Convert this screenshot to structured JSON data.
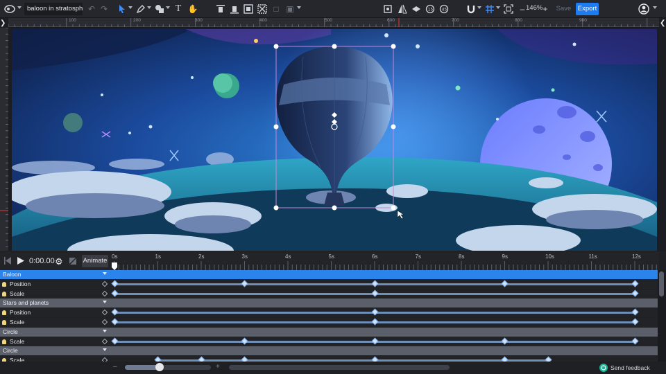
{
  "app": {
    "document_name": "baloon in stratosphere",
    "zoom": "146%",
    "save_label": "Save",
    "export_label": "Export",
    "accent_color": "#1f7cf0"
  },
  "toolbar": {
    "left_icons": [
      "app-logo-icon",
      "undo-icon",
      "redo-icon",
      "pointer-tool-icon",
      "pen-tool-icon",
      "shape-tool-icon",
      "text-tool-icon",
      "hand-tool-icon"
    ],
    "align_icons": [
      "align-top-icon",
      "align-middle-icon",
      "align-group-icon",
      "align-distribute-icon",
      "boolean-icon",
      "arrange-icon"
    ],
    "view_icons": [
      "crop-icon",
      "flip-icon",
      "mask-icon",
      "rotate-left-icon",
      "rotate-right-icon",
      "magnet-icon",
      "grid-icon",
      "fit-icon"
    ],
    "text_tool": "T",
    "zoom_minus": "–",
    "zoom_plus": "+"
  },
  "ruler": {
    "top_labels": [
      "100",
      "200",
      "300",
      "400",
      "500",
      "600",
      "700",
      "800",
      "900"
    ],
    "left_labels": [
      "-100",
      "0",
      "100",
      "200",
      "300"
    ]
  },
  "timeline": {
    "time": "0:00.00",
    "animate_label": "Animate",
    "ticks": [
      "0s",
      "1s",
      "2s",
      "3s",
      "4s",
      "5s",
      "6s",
      "7s",
      "8s",
      "9s",
      "10s",
      "11s",
      "12s"
    ],
    "rows": [
      {
        "type": "group",
        "label": "Baloon",
        "active": true
      },
      {
        "type": "prop",
        "label": "Position",
        "keyframes": [
          0,
          3,
          6,
          9,
          12
        ]
      },
      {
        "type": "prop",
        "label": "Scale",
        "keyframes": [
          0,
          6,
          12
        ]
      },
      {
        "type": "group",
        "label": "Stars and planets",
        "active": false
      },
      {
        "type": "prop",
        "label": "Position",
        "keyframes": [
          0,
          6,
          12
        ]
      },
      {
        "type": "prop",
        "label": "Scale",
        "keyframes": [
          0,
          6,
          12
        ]
      },
      {
        "type": "group",
        "label": "Circle",
        "active": false
      },
      {
        "type": "prop",
        "label": "Scale",
        "keyframes": [
          0,
          3,
          6,
          9,
          12
        ]
      },
      {
        "type": "group",
        "label": "Circle",
        "active": false
      },
      {
        "type": "prop",
        "label": "Scale",
        "keyframes": [
          1,
          2,
          3,
          6,
          9,
          10
        ]
      }
    ],
    "zoom_minus": "–",
    "zoom_plus": "+",
    "zoom_level": 0.4,
    "feedback_label": "Send feedback"
  }
}
